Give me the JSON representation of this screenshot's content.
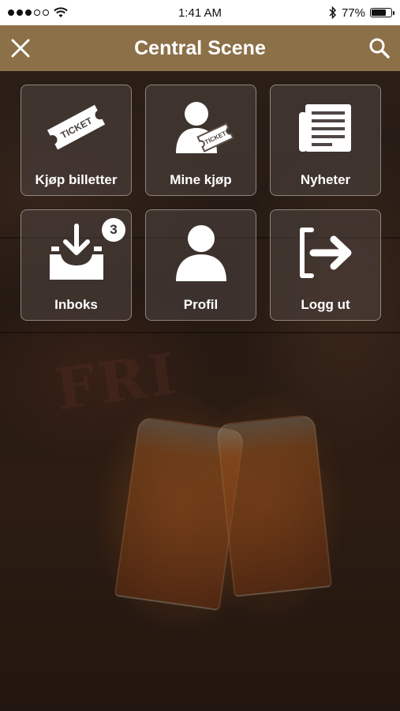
{
  "status_bar": {
    "time": "1:41 AM",
    "battery_percent": "77%",
    "battery_level": 0.77,
    "signal_dots_filled": 3,
    "signal_dots_total": 5,
    "icons": [
      "signal-dots-icon",
      "wifi-icon",
      "bluetooth-icon",
      "battery-icon"
    ]
  },
  "nav": {
    "title": "Central Scene",
    "background_color": "#8c7048",
    "left_icon": "close-icon",
    "right_icon": "search-icon"
  },
  "tiles": [
    {
      "label": "Kjøp billetter",
      "icon": "ticket-icon"
    },
    {
      "label": "Mine kjøp",
      "icon": "user-ticket-icon"
    },
    {
      "label": "Nyheter",
      "icon": "newspaper-icon"
    },
    {
      "label": "Inboks",
      "icon": "inbox-download-icon",
      "badge": "3"
    },
    {
      "label": "Profil",
      "icon": "user-icon"
    },
    {
      "label": "Logg ut",
      "icon": "logout-icon"
    }
  ],
  "icon_text": {
    "ticket": "TICKET",
    "user_ticket": "TICKET"
  }
}
